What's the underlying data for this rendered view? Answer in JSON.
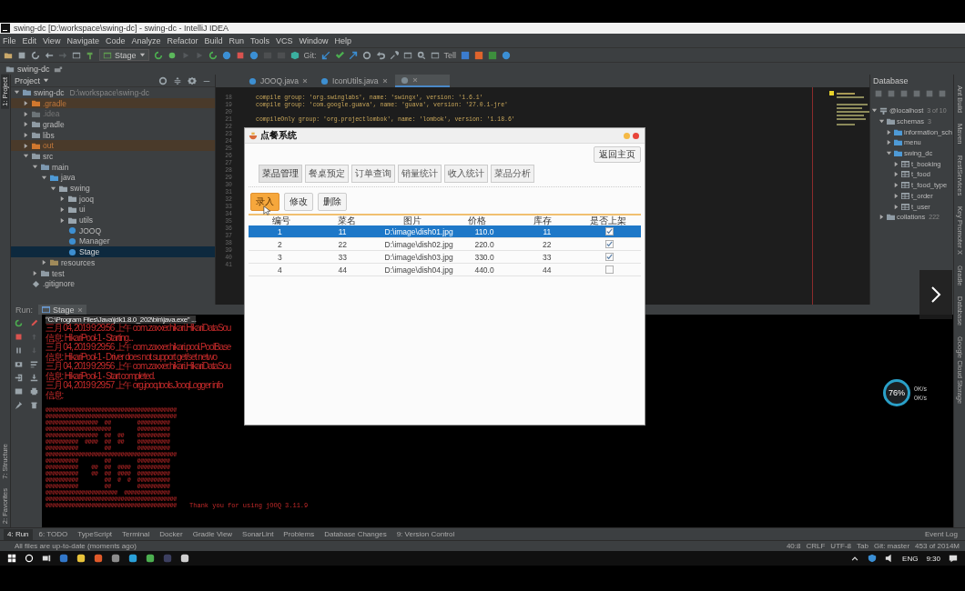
{
  "window": {
    "title": "swing-dc [D:\\workspace\\swing-dc] - swing-dc - IntelliJ IDEA"
  },
  "menu": [
    "File",
    "Edit",
    "View",
    "Navigate",
    "Code",
    "Analyze",
    "Refactor",
    "Build",
    "Run",
    "Tools",
    "VCS",
    "Window",
    "Help"
  ],
  "toolbar": {
    "run_config": "Stage",
    "git_label": "Git:",
    "tell_label": "Tell"
  },
  "breadcrumb": [
    "swing-dc"
  ],
  "left_stripe": {
    "top": [
      {
        "label": "1: Project",
        "selected": true
      }
    ],
    "bottom": [
      {
        "label": "7: Structure",
        "selected": false
      },
      {
        "label": "2: Favorites",
        "selected": false
      }
    ]
  },
  "right_stripe": [
    "Ant Build",
    "Maven",
    "RestServices",
    "Key Promoter X",
    "Gradle",
    "Database",
    "Google Cloud Storage"
  ],
  "project": {
    "title": "Project",
    "tree": [
      {
        "label": "swing-dc",
        "path": "D:\\workspace\\swing-dc",
        "kind": "module",
        "expanded": true,
        "selected": false,
        "children": [
          {
            "label": ".gradle",
            "kind": "excluded",
            "expanded": false,
            "selected": false
          },
          {
            "label": ".idea",
            "kind": "ignored",
            "expanded": false,
            "selected": false
          },
          {
            "label": "gradle",
            "kind": "folder",
            "expanded": false,
            "selected": false
          },
          {
            "label": "libs",
            "kind": "folder",
            "expanded": false,
            "selected": false
          },
          {
            "label": "out",
            "kind": "excluded",
            "expanded": false,
            "selected": false
          },
          {
            "label": "src",
            "kind": "folder",
            "expanded": true,
            "selected": false,
            "children": [
              {
                "label": "main",
                "kind": "module",
                "expanded": true,
                "selected": false,
                "children": [
                  {
                    "label": "java",
                    "kind": "source",
                    "expanded": true,
                    "selected": false,
                    "children": [
                      {
                        "label": "swing",
                        "kind": "package",
                        "expanded": true,
                        "selected": false,
                        "children": [
                          {
                            "label": "jooq",
                            "kind": "package",
                            "expanded": false,
                            "selected": false
                          },
                          {
                            "label": "ui",
                            "kind": "package",
                            "expanded": false,
                            "selected": false
                          },
                          {
                            "label": "utils",
                            "kind": "package",
                            "expanded": false,
                            "selected": false
                          },
                          {
                            "label": "JOOQ",
                            "kind": "class",
                            "selected": false
                          },
                          {
                            "label": "Manager",
                            "kind": "class",
                            "selected": false
                          },
                          {
                            "label": "Stage",
                            "kind": "class",
                            "selected": true
                          }
                        ]
                      }
                    ]
                  },
                  {
                    "label": "resources",
                    "kind": "resources",
                    "expanded": false,
                    "selected": false
                  }
                ]
              },
              {
                "label": "test",
                "kind": "folder",
                "expanded": false,
                "selected": false
              }
            ]
          },
          {
            "label": ".gitignore",
            "kind": "file",
            "selected": false
          }
        ]
      }
    ]
  },
  "editor": {
    "tabs": [
      {
        "label": "JOOQ.java",
        "selected": false
      },
      {
        "label": "IconUtils.java",
        "selected": false
      },
      {
        "selected": true
      }
    ],
    "lines": [
      {
        "number": "18",
        "text": "compile group: 'org.swinglabs', name: 'swingx', version: '1.6.1'"
      },
      {
        "number": "19",
        "text": "compile group: 'com.google.guava', name: 'guava', version: '27.0.1-jre'"
      },
      {
        "number": "20"
      },
      {
        "number": "21",
        "text": "compileOnly group: 'org.projectlombok', name: 'lombok', version: '1.18.6'"
      },
      {
        "number": "22"
      },
      {
        "number": "23"
      },
      {
        "number": "24"
      },
      {
        "number": "25"
      },
      {
        "number": "26"
      },
      {
        "number": "27"
      },
      {
        "number": "28"
      },
      {
        "number": "29"
      },
      {
        "number": "30"
      },
      {
        "number": "31"
      },
      {
        "number": "32"
      },
      {
        "number": "33"
      },
      {
        "number": "34"
      },
      {
        "number": "35"
      },
      {
        "number": "36"
      },
      {
        "number": "37"
      },
      {
        "number": "38"
      },
      {
        "number": "39"
      },
      {
        "number": "40"
      },
      {
        "number": "41"
      }
    ]
  },
  "database": {
    "title": "Database",
    "tree": [
      {
        "label": "@localhost",
        "count": "3 of 10",
        "kind": "host",
        "expanded": true,
        "children": [
          {
            "label": "schemas",
            "count": "3",
            "kind": "folder",
            "expanded": true,
            "children": [
              {
                "label": "information_sch",
                "kind": "schema",
                "expanded": false
              },
              {
                "label": "menu",
                "kind": "schema",
                "expanded": false
              },
              {
                "label": "swing_dc",
                "kind": "schema",
                "expanded": true,
                "children": [
                  {
                    "label": "t_booking",
                    "kind": "table",
                    "expanded": false
                  },
                  {
                    "label": "t_food",
                    "kind": "table",
                    "expanded": false
                  },
                  {
                    "label": "t_food_type",
                    "kind": "table",
                    "expanded": false
                  },
                  {
                    "label": "t_order",
                    "kind": "table",
                    "expanded": false
                  },
                  {
                    "label": "t_user",
                    "kind": "table",
                    "expanded": false
                  }
                ]
              }
            ]
          },
          {
            "label": "collations",
            "count": "222",
            "kind": "folder",
            "expanded": false
          }
        ]
      }
    ]
  },
  "run": {
    "label": "Run:",
    "tab": "Stage",
    "command": "\"C:\\Program Files\\Java\\jdk1.8.0_202\\bin\\java.exe\" ...",
    "log": [
      "三月 04, 2019 9:29:56 上午 com.zaxxer.hikari.HikariDataSou",
      "信息: HikariPool-1 - Starting...",
      "三月 04, 2019 9:29:56 上午 com.zaxxer.hikari.pool.PoolBase",
      "信息: HikariPool-1 - Driver does not support get/set netwo",
      "三月 04, 2019 9:29:56 上午 com.zaxxer.hikari.HikariDataSou",
      "信息: HikariPool-1 - Start completed.",
      "三月 04, 2019 9:29:57 上午 org.jooq.tools.JooqLogger info",
      "信息:"
    ],
    "art": [
      "@@@@@@@@@@@@@@@@@@@@@@@@@@@@@@@@@@@@@@@@",
      "@@@@@@@@@@@@@@@@@@@@@@@@@@@@@@@@@@@@@@@@",
      "@@@@@@@@@@@@@@@@  @@        @@@@@@@@@@",
      "@@@@@@@@@@@@@@@@@@@@        @@@@@@@@@@",
      "@@@@@@@@@@@@@@@@  @@  @@    @@@@@@@@@@",
      "@@@@@@@@@@  @@@@  @@  @@    @@@@@@@@@@",
      "@@@@@@@@@@        @@        @@@@@@@@@@",
      "@@@@@@@@@@@@@@@@@@@@@@@@@@@@@@@@@@@@@@@@",
      "@@@@@@@@@@        @@        @@@@@@@@@@",
      "@@@@@@@@@@    @@  @@  @@@@  @@@@@@@@@@",
      "@@@@@@@@@@    @@  @@  @@@@  @@@@@@@@@@",
      "@@@@@@@@@@        @@  @  @  @@@@@@@@@@",
      "@@@@@@@@@@        @@        @@@@@@@@@@",
      "@@@@@@@@@@@@@@@@@@@@@@  @@@@@@@@@@@@@@",
      "@@@@@@@@@@@@@@@@@@@@@@@@@@@@@@@@@@@@@@@@",
      "@@@@@@@@@@@@@@@@@@@@@@@@@@@@@@@@@@@@@@@@"
    ],
    "closing": "Thank you for using jOOQ 3.11.9"
  },
  "dialog": {
    "title": "点餐系统",
    "home_button": "返回主页",
    "tabs": [
      {
        "label": "菜品管理",
        "selected": true
      },
      {
        "label": "餐桌预定",
        "selected": false
      },
      {
        "label": "订单查询",
        "selected": false
      },
      {
        "label": "销量统计",
        "selected": false
      },
      {
        "label": "收入统计",
        "selected": false
      },
      {
        "label": "菜品分析",
        "selected": false
      }
    ],
    "buttons": [
      {
        "label": "录入",
        "highlighted": true
      },
      {
        "label": "修改",
        "highlighted": false
      },
      {
        "label": "删除",
        "highlighted": false
      }
    ],
    "columns": [
      "编号",
      "菜名",
      "图片",
      "价格",
      "库存",
      "是否上架"
    ],
    "rows": [
      {
        "cells": [
          "1",
          "11",
          "D:\\image\\dish01.jpg",
          "110.0",
          "11"
        ],
        "on_sale": true,
        "selected": true
      },
      {
        "cells": [
          "2",
          "22",
          "D:\\image\\dish02.jpg",
          "220.0",
          "22"
        ],
        "on_sale": true,
        "selected": false
      },
      {
        "cells": [
          "3",
          "33",
          "D:\\image\\dish03.jpg",
          "330.0",
          "33"
        ],
        "on_sale": true,
        "selected": false
      },
      {
        "cells": [
          "4",
          "44",
          "D:\\image\\dish04.jpg",
          "440.0",
          "44"
        ],
        "on_sale": false,
        "selected": false
      }
    ]
  },
  "speed_widget": {
    "percent": "76%",
    "readings": [
      "0K/s",
      "0K/s"
    ]
  },
  "tool_tabs": [
    {
      "label": "4: Run",
      "selected": true
    },
    {
      "label": "6: TODO",
      "selected": false
    },
    {
      "label": "TypeScript",
      "selected": false
    },
    {
      "label": "Terminal",
      "selected": false
    },
    {
      "label": "Docker",
      "selected": false
    },
    {
      "label": "Gradle View",
      "selected": false
    },
    {
      "label": "SonarLint",
      "selected": false
    },
    {
      "label": "Problems",
      "selected": false
    },
    {
      "label": "Database Changes",
      "selected": false
    },
    {
      "label": "9: Version Control",
      "selected": false
    }
  ],
  "event_log": "Event Log",
  "status_bar": {
    "message": "All files are up-to-date (moments ago)",
    "items": [
      "40:8",
      "CRLF",
      "UTF-8",
      "Tab",
      "Git: master",
      "453 of 2014M"
    ]
  },
  "taskbar": {
    "language": "ENG",
    "time": "9:30"
  }
}
